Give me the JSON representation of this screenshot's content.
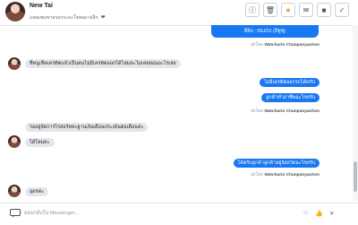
{
  "header": {
    "name": "New Tai",
    "subtitle": "แคมเพนขายรถกระบะโฆษณาปลีก",
    "heart": "❤",
    "buttons": [
      {
        "name": "info-button",
        "icon": "info-icon",
        "glyph": "ⓘ"
      },
      {
        "name": "delete-button",
        "icon": "trash-icon",
        "glyph": "🗑"
      },
      {
        "name": "star-button",
        "icon": "star-icon",
        "glyph": "★"
      },
      {
        "name": "mail-button",
        "icon": "mail-icon",
        "glyph": "✉"
      },
      {
        "name": "stop-button",
        "icon": "block-icon",
        "glyph": "■"
      },
      {
        "name": "check-button",
        "icon": "check-icon",
        "glyph": "✓"
      }
    ]
  },
  "messages": {
    "top": "ยี่ห้อ : ISUZU (อีซูซุ)",
    "sent1": "ส่งโดย",
    "agent": "Watcharin Chanpanyachon",
    "m1": "ที่หนูเช็คเครดิตแล้วเป็นคนไม่มีเครดิตออกได้ไหมคะไม่เคยผ่อนอะไรเลย",
    "m2": "ไม่มีเครดิตออกรถได้ครับ",
    "m3": "ลูกค้าทำอาชีพอะไรครับ",
    "m4": "รออยู่จัดการไรสอร์ทค่ะฐานเงินเดือนประเมินต่อเดือนค่ะ",
    "m5": "ได้ไหมคะ",
    "m6": "ได้ครับลูกค้าลูกค้าอยู่จังหวัดอะไรครับ",
    "m7": "อุดรค่ะ"
  },
  "composer": {
    "placeholder": "ตอบกลับใน Messenger...",
    "icons": [
      "chat-icon",
      "emoji-icon",
      "like-icon",
      "send-icon"
    ]
  }
}
